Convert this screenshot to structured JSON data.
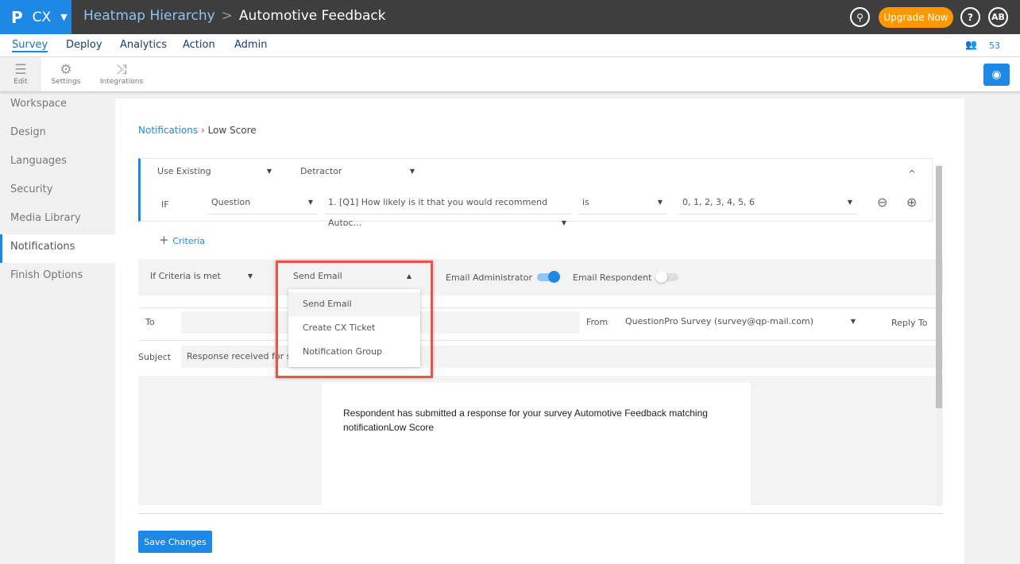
{
  "header": {
    "product": "CX",
    "breadcrumb_parent": "Heatmap Hierarchy",
    "breadcrumb_sep": ">",
    "title": "Automotive Feedback",
    "upgrade": "Upgrade Now",
    "avatar": "AB",
    "search_icon": "search-icon",
    "help": "?"
  },
  "nav": {
    "items": [
      "Survey",
      "Deploy",
      "Analytics",
      "Action",
      "Admin"
    ],
    "active": "Survey",
    "user_count": "53"
  },
  "toolbar": {
    "items": [
      "Edit",
      "Settings",
      "Integrations"
    ]
  },
  "sidebar": {
    "items": [
      "Workspace",
      "Design",
      "Languages",
      "Security",
      "Media Library",
      "Notifications",
      "Finish Options"
    ],
    "active": "Notifications"
  },
  "page": {
    "breadcrumb_parent": "Notifications",
    "breadcrumb_current": "Low Score"
  },
  "criteria": {
    "use_existing": "Use Existing",
    "segment": "Detractor",
    "if": "IF",
    "field": "Question",
    "question": "1. [Q1] How likely is it that you would recommend Autoc...",
    "operator": "is",
    "values": "0, 1, 2, 3, 4, 5, 6",
    "add_criteria": "Criteria"
  },
  "action": {
    "condition": "If Criteria is met",
    "selected": "Send Email",
    "options": [
      "Send Email",
      "Create CX Ticket",
      "Notification Group"
    ],
    "email_admin": "Email Administrator",
    "email_admin_on": true,
    "email_respondent": "Email Respondent",
    "email_respondent_on": false
  },
  "email": {
    "to_label": "To",
    "to_value": "",
    "from_label": "From",
    "from_value": "QuestionPro Survey (survey@qp-mail.com)",
    "reply_to": "Reply To",
    "subject_label": "Subject",
    "subject_value": "Response received for survey",
    "body": "Respondent has submitted a response for your survey Automotive Feedback matching notificationLow Score"
  },
  "save": "Save Changes",
  "colors": {
    "accent": "#1e88e5",
    "upgrade": "#ff9800",
    "highlight": "#e8534a"
  }
}
